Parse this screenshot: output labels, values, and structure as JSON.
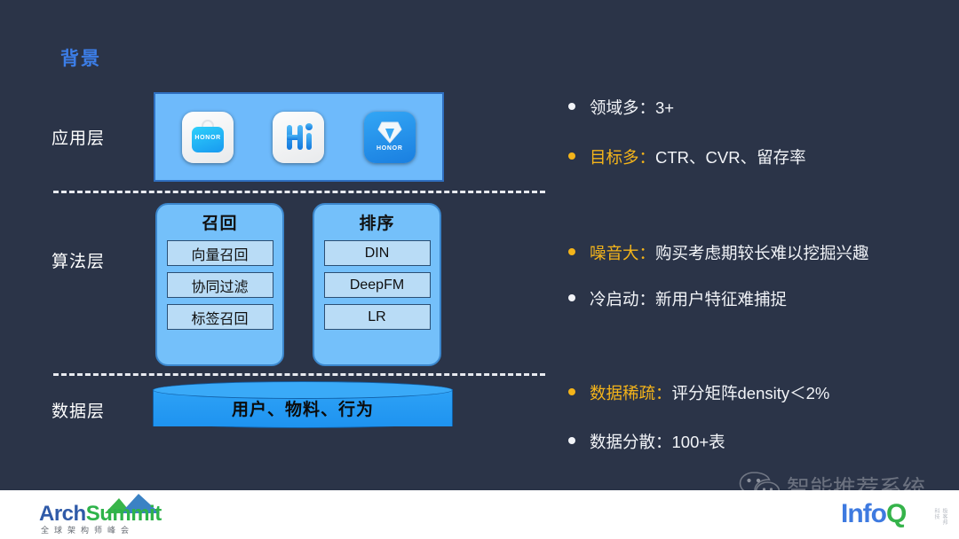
{
  "slide": {
    "title": "背景",
    "background_color": "#2b3448",
    "accent_color": "#3c7ee8",
    "highlight_color": "#f4b41a"
  },
  "diagram": {
    "layers": [
      {
        "id": "app",
        "label": "应用层"
      },
      {
        "id": "algo",
        "label": "算法层"
      },
      {
        "id": "data",
        "label": "数据层"
      }
    ],
    "app_layer": {
      "icons": [
        {
          "name": "honor-store-icon",
          "text": "HONOR"
        },
        {
          "name": "honor-hi-icon",
          "text": "Hi"
        },
        {
          "name": "honor-diamond-icon",
          "text": "HONOR"
        }
      ]
    },
    "algorithm_layer": {
      "groups": [
        {
          "title": "召回",
          "items": [
            "向量召回",
            "协同过滤",
            "标签召回"
          ]
        },
        {
          "title": "排序",
          "items": [
            "DIN",
            "DeepFM",
            "LR"
          ]
        }
      ]
    },
    "data_layer": {
      "cylinder_label": "用户、物料、行为"
    }
  },
  "bullets": [
    {
      "label": "领域多：",
      "value": "3+",
      "highlight": false
    },
    {
      "label": "目标多：",
      "value": "CTR、CVR、留存率",
      "highlight": true
    },
    {
      "label": "噪音大：",
      "value": "购买考虑期较长难以挖掘兴趣",
      "highlight": true
    },
    {
      "label": "冷启动：",
      "value": "新用户特征难捕捉",
      "highlight": false
    },
    {
      "label": "数据稀疏：",
      "value": "评分矩阵density＜2%",
      "highlight": true
    },
    {
      "label": "数据分散：",
      "value": "100+表",
      "highlight": false
    }
  ],
  "footer": {
    "archsummit": {
      "word_a": "Arch",
      "word_b": "Summit",
      "subtitle": "全球架构师峰会"
    },
    "infoq": {
      "word_a": "Info",
      "word_b": "Q",
      "tagline": "极客邦科技"
    },
    "watermark": {
      "text": "智能推荐系统"
    }
  }
}
